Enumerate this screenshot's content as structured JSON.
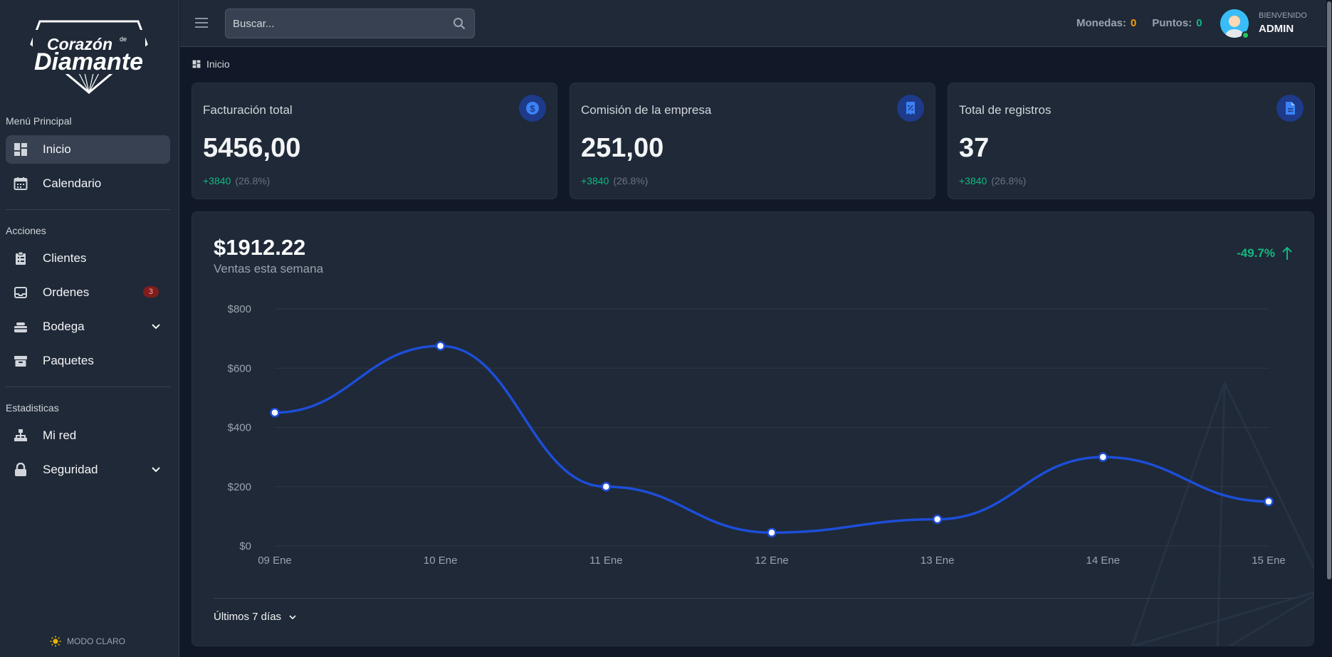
{
  "brand": {
    "line1": "Corazón",
    "line1_small": "de",
    "line2": "Diamante"
  },
  "sidebar": {
    "section_main": "Menú Principal",
    "section_actions": "Acciones",
    "section_stats": "Estadisticas",
    "items": [
      {
        "label": "Inicio",
        "icon": "dashboard-icon",
        "active": true
      },
      {
        "label": "Calendario",
        "icon": "calendar-icon"
      },
      {
        "label": "Clientes",
        "icon": "clipboard-icon"
      },
      {
        "label": "Ordenes",
        "icon": "inbox-icon",
        "badge": "3"
      },
      {
        "label": "Bodega",
        "icon": "stack-icon",
        "expandable": true
      },
      {
        "label": "Paquetes",
        "icon": "archive-icon"
      },
      {
        "label": "Mi red",
        "icon": "network-icon"
      },
      {
        "label": "Seguridad",
        "icon": "lock-icon",
        "expandable": true
      }
    ],
    "mode_label": "MODO CLARO"
  },
  "header": {
    "search_placeholder": "Buscar...",
    "coins_label": "Monedas:",
    "coins_value": "0",
    "points_label": "Puntos:",
    "points_value": "0",
    "welcome": "BIENVENIDO",
    "user": "ADMIN"
  },
  "breadcrumb": "Inicio",
  "cards": [
    {
      "title": "Facturación total",
      "value": "5456,00",
      "delta": "+3840",
      "pct": "(26.8%)",
      "icon": "dollar-icon"
    },
    {
      "title": "Comisión de la empresa",
      "value": "251,00",
      "delta": "+3840",
      "pct": "(26.8%)",
      "icon": "receipt-icon"
    },
    {
      "title": "Total de registros",
      "value": "37",
      "delta": "+3840",
      "pct": "(26.8%)",
      "icon": "document-icon"
    }
  ],
  "sales": {
    "total": "$1912.22",
    "subtitle": "Ventas esta semana",
    "change": "-49.7%",
    "range_label": "Últimos 7 días"
  },
  "chart_data": {
    "type": "line",
    "x": [
      "09 Ene",
      "10 Ene",
      "11 Ene",
      "12 Ene",
      "13 Ene",
      "14 Ene",
      "15 Ene"
    ],
    "series": [
      {
        "values": [
          450,
          675,
          200,
          45,
          90,
          300,
          150
        ]
      }
    ],
    "ylim": [
      0,
      800
    ],
    "yticks": [
      "$0",
      "$200",
      "$400",
      "$600",
      "$800"
    ],
    "color": "#1d4ed8",
    "grid": true
  }
}
